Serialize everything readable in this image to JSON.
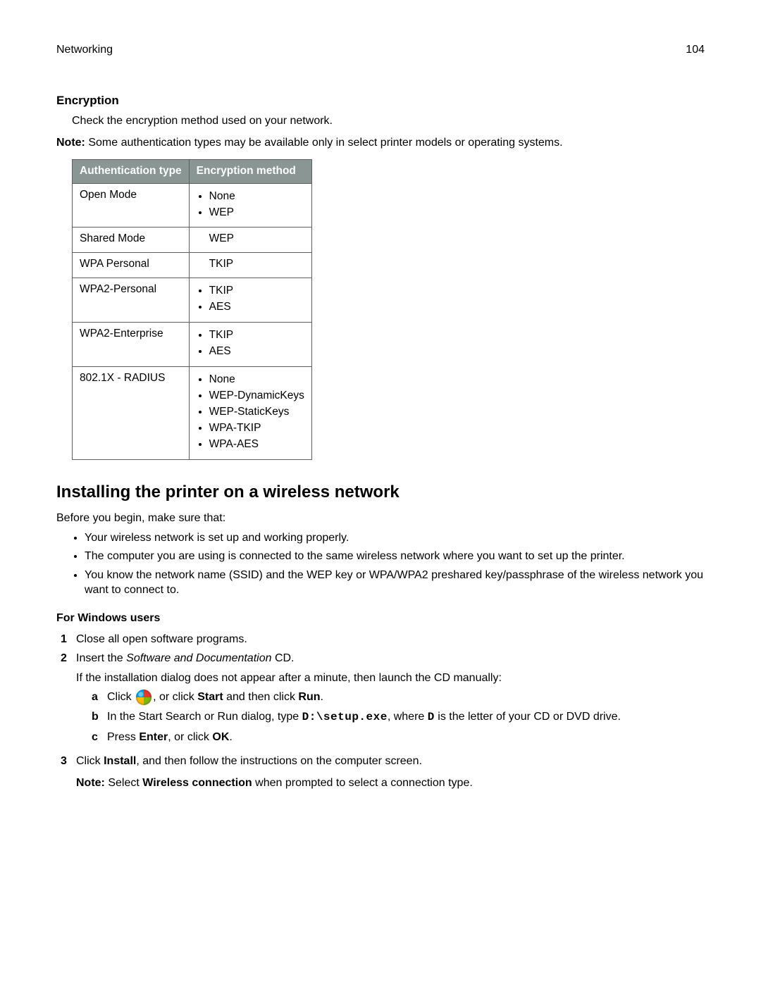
{
  "header": {
    "section": "Networking",
    "page": "104"
  },
  "encryption": {
    "heading": "Encryption",
    "intro": "Check the encryption method used on your network.",
    "note_label": "Note:",
    "note_text": " Some authentication types may be available only in select printer models or operating systems.",
    "th_auth": "Authentication type",
    "th_enc": "Encryption method",
    "rows": {
      "open": {
        "auth": "Open Mode",
        "items": [
          "None",
          "WEP"
        ]
      },
      "shared": {
        "auth": "Shared Mode",
        "single": "WEP"
      },
      "wpa": {
        "auth": "WPA Personal",
        "single": "TKIP"
      },
      "wpa2p": {
        "auth": "WPA2-Personal",
        "items": [
          "TKIP",
          "AES"
        ]
      },
      "wpa2e": {
        "auth": "WPA2-Enterprise",
        "items": [
          "TKIP",
          "AES"
        ]
      },
      "radius": {
        "auth": "802.1X - RADIUS",
        "items": [
          "None",
          "WEP-DynamicKeys",
          "WEP-StaticKeys",
          "WPA-TKIP",
          "WPA-AES"
        ]
      }
    }
  },
  "install": {
    "heading": "Installing the printer on a wireless network",
    "before": "Before you begin, make sure that:",
    "bullets": [
      "Your wireless network is set up and working properly.",
      "The computer you are using is connected to the same wireless network where you want to set up the printer.",
      "You know the network name (SSID) and the WEP key or WPA/WPA2 preshared key/passphrase of the wireless network you want to connect to."
    ],
    "windows": {
      "heading": "For Windows users",
      "step1": "Close all open software programs.",
      "step2_a": "Insert the ",
      "step2_em": "Software and Documentation",
      "step2_b": " CD.",
      "step2_note": "If the installation dialog does not appear after a minute, then launch the CD manually:",
      "sub_a_1": "Click ",
      "sub_a_2": ", or click ",
      "sub_a_start": "Start",
      "sub_a_3": " and then click ",
      "sub_a_run": "Run",
      "sub_a_4": ".",
      "sub_b_1": "In the Start Search or Run dialog, type ",
      "sub_b_code": "D:\\setup.exe",
      "sub_b_2": ", where ",
      "sub_b_D": "D",
      "sub_b_3": " is the letter of your CD or DVD drive.",
      "sub_c_1": "Press ",
      "sub_c_enter": "Enter",
      "sub_c_2": ", or click ",
      "sub_c_ok": "OK",
      "sub_c_3": ".",
      "step3_1": "Click ",
      "step3_install": "Install",
      "step3_2": ", and then follow the instructions on the computer screen.",
      "step3_note_label": "Note:",
      "step3_note_1": " Select ",
      "step3_note_bold": "Wireless connection",
      "step3_note_2": " when prompted to select a connection type."
    }
  },
  "markers": {
    "n1": "1",
    "n2": "2",
    "n3": "3",
    "la": "a",
    "lb": "b",
    "lc": "c"
  }
}
